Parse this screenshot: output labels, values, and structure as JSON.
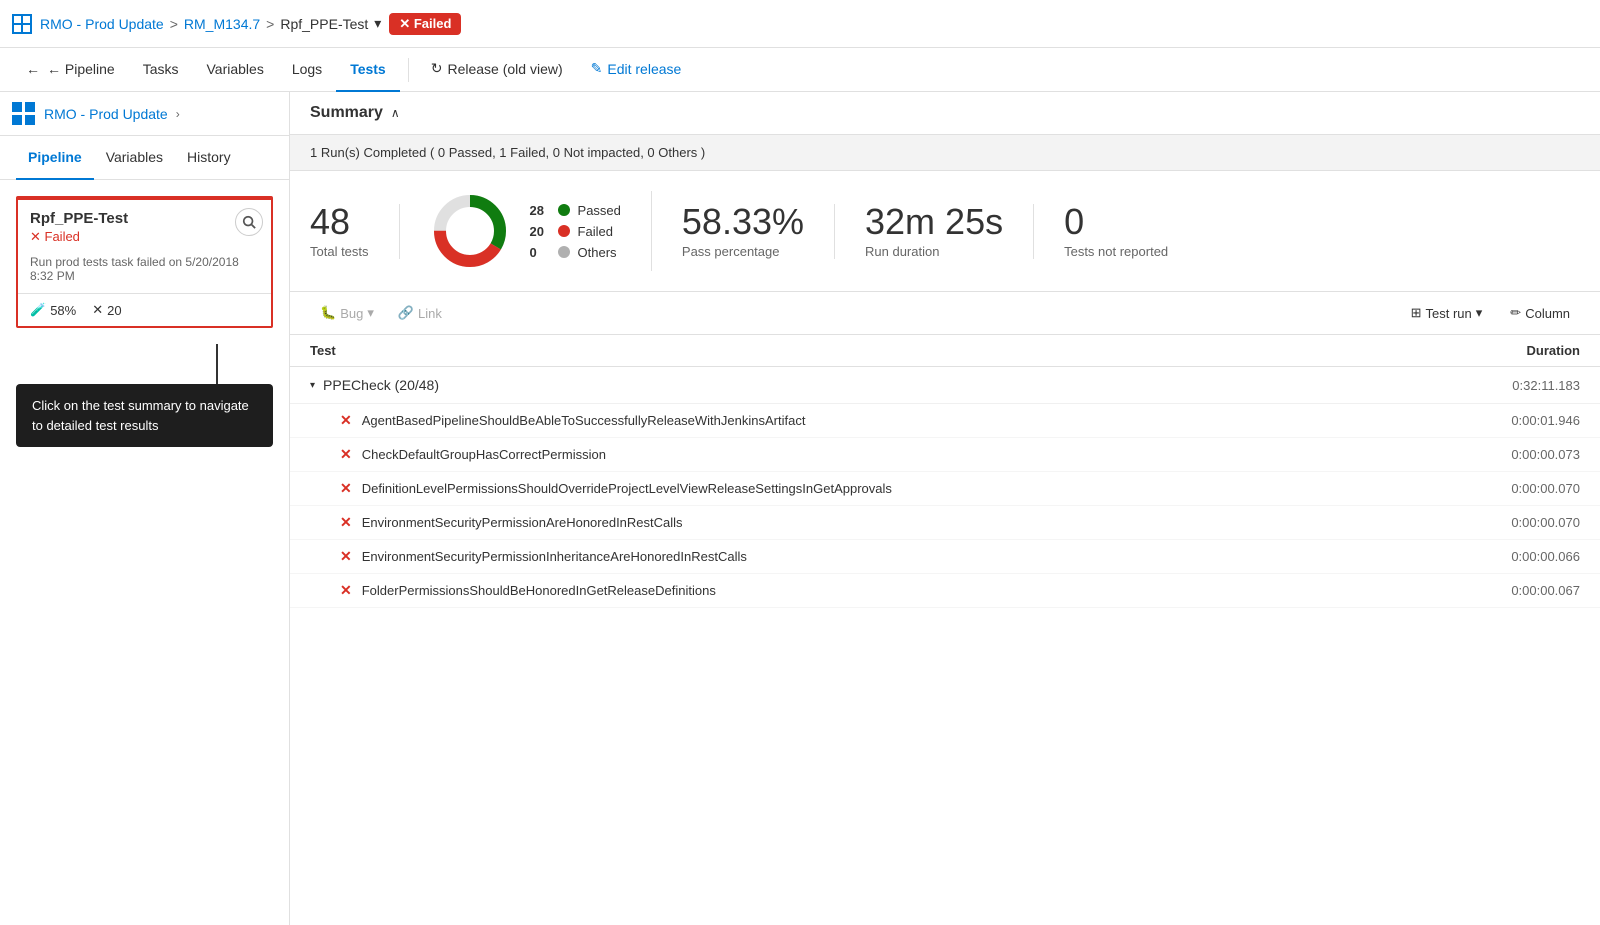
{
  "topBar": {
    "logoAlt": "Azure DevOps",
    "breadcrumb": {
      "project": "RMO - Prod Update",
      "separator1": ">",
      "release": "RM_M134.7",
      "separator2": ">",
      "stage": "Rpf_PPE-Test",
      "dropdownArrow": "▾",
      "statusBadge": "✕ Failed"
    }
  },
  "secondNav": {
    "backLabel": "← Pipeline",
    "tasksLabel": "Tasks",
    "variablesLabel": "Variables",
    "logsLabel": "Logs",
    "testsLabel": "Tests",
    "releaseOldLabel": "↻  Release (old view)",
    "editReleaseLabel": "✎  Edit release"
  },
  "sidebar": {
    "tabs": [
      {
        "label": "Pipeline",
        "active": true
      },
      {
        "label": "Variables",
        "active": false
      },
      {
        "label": "History",
        "active": false
      }
    ],
    "brandTitle": "RMO - Prod Update",
    "stage": {
      "name": "Rpf_PPE-Test",
      "status": "✕ Failed",
      "description": "Run prod tests task failed on 5/20/2018 8:32 PM",
      "passPercent": "58%",
      "failCount": "✕ 20"
    },
    "tooltip": "Click on the test summary to navigate to detailed test results"
  },
  "summary": {
    "title": "Summary",
    "collapseIcon": "∧",
    "runInfo": "1 Run(s) Completed ( 0 Passed, 1 Failed, 0 Not impacted, 0 Others )",
    "stats": {
      "totalTests": "48",
      "totalLabel": "Total tests",
      "passedCount": "28",
      "failedCount": "20",
      "othersCount": "0",
      "passedLabel": "Passed",
      "failedLabel": "Failed",
      "othersLabel": "Others",
      "passPercent": "58.33%",
      "passPercentLabel": "Pass percentage",
      "runDuration": "32m 25s",
      "runDurationLabel": "Run duration",
      "notReported": "0",
      "notReportedLabel": "Tests not reported"
    },
    "donut": {
      "passedDeg": 209,
      "failedDeg": 151,
      "passedColor": "#107c10",
      "failedColor": "#d93025",
      "othersColor": "#b0b0b0"
    }
  },
  "toolbar": {
    "bugLabel": "Bug",
    "bugDropArrow": "▾",
    "linkLabel": "Link",
    "testRunLabel": "Test run",
    "testRunArrow": "▾",
    "columnLabel": "Column"
  },
  "table": {
    "headers": {
      "test": "Test",
      "duration": "Duration"
    },
    "groups": [
      {
        "name": "PPECheck (20/48)",
        "duration": "0:32:11.183",
        "expanded": true,
        "tests": [
          {
            "name": "AgentBasedPipelineShouldBeAbleToSuccessfullyReleaseWithJenkinsArtifact",
            "duration": "0:00:01.946",
            "status": "fail"
          },
          {
            "name": "CheckDefaultGroupHasCorrectPermission",
            "duration": "0:00:00.073",
            "status": "fail"
          },
          {
            "name": "DefinitionLevelPermissionsShouldOverrideProjectLevelViewReleaseSettingsInGetApprovals",
            "duration": "0:00:00.070",
            "status": "fail"
          },
          {
            "name": "EnvironmentSecurityPermissionAreHonoredInRestCalls",
            "duration": "0:00:00.070",
            "status": "fail"
          },
          {
            "name": "EnvironmentSecurityPermissionInheritanceAreHonoredInRestCalls",
            "duration": "0:00:00.066",
            "status": "fail"
          },
          {
            "name": "FolderPermissionsShouldBeHonoredInGetReleaseDefinitions",
            "duration": "0:00:00.067",
            "status": "fail"
          }
        ]
      }
    ]
  }
}
